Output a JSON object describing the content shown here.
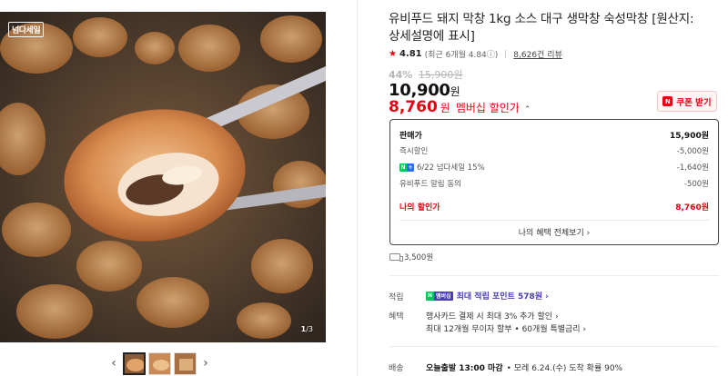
{
  "gallery": {
    "brand_badge": "넘다세일",
    "counter_current": "1",
    "counter_total": "3",
    "prev_glyph": "‹",
    "next_glyph": "›"
  },
  "product": {
    "title": "유비푸드 돼지 막창 1kg 소스 대구 생막창 숙성막창 [원산지: 상세설명에 표시]",
    "rating": "4.81",
    "rating_recent": "(최근 6개월 4.84ⓘ)",
    "review_count": "8,626건 리뷰",
    "discount_rate": "44%",
    "original_price": "15,900원",
    "price": "10,900",
    "price_unit": "원",
    "member_price": "8,760",
    "member_unit": "원",
    "member_label": "멤버십 할인가",
    "member_chevron": "⌃",
    "coupon_label": "쿠폰 받기",
    "coupon_mark": "N"
  },
  "price_box": {
    "rows": [
      {
        "label": "판매가",
        "value": "15,900원"
      },
      {
        "label": "즉시할인",
        "value": "-5,000원"
      },
      {
        "label": "6/22 넘다세일 15%",
        "value": "-1,640원"
      },
      {
        "label": "유비푸드 알림 동의",
        "value": "-500원"
      }
    ],
    "my_price_label": "나의 할인가",
    "my_price_value": "8,760원",
    "all_benefits": "나의 혜택 전체보기 ›"
  },
  "delivery": {
    "fee": "3,500원"
  },
  "details": {
    "points_label": "적립",
    "points_badge": "멤버십",
    "points_text": "최대 적립 포인트 578원 ›",
    "benefit_label": "혜택",
    "benefit_line1": "행사카드 결제 시 최대 3% 추가 할인 ›",
    "benefit_line2": "최대 12개월 무이자 할부 • 60개월 특별금리 ›",
    "shipping_label": "배송",
    "shipping_bold": "오늘출발 13:00 마감",
    "shipping_rest": "• 모레 6.24.(수) 도착 확률 90%"
  },
  "colors": {
    "accent_red": "#e60012",
    "naver_green": "#03c75a",
    "membership_purple": "#4a3cb5"
  },
  "icons": [
    "star-icon",
    "info-icon",
    "chevron-up-icon",
    "naver-n-icon",
    "npay-icon",
    "truck-icon",
    "chevron-right-icon",
    "chevron-left-icon"
  ]
}
